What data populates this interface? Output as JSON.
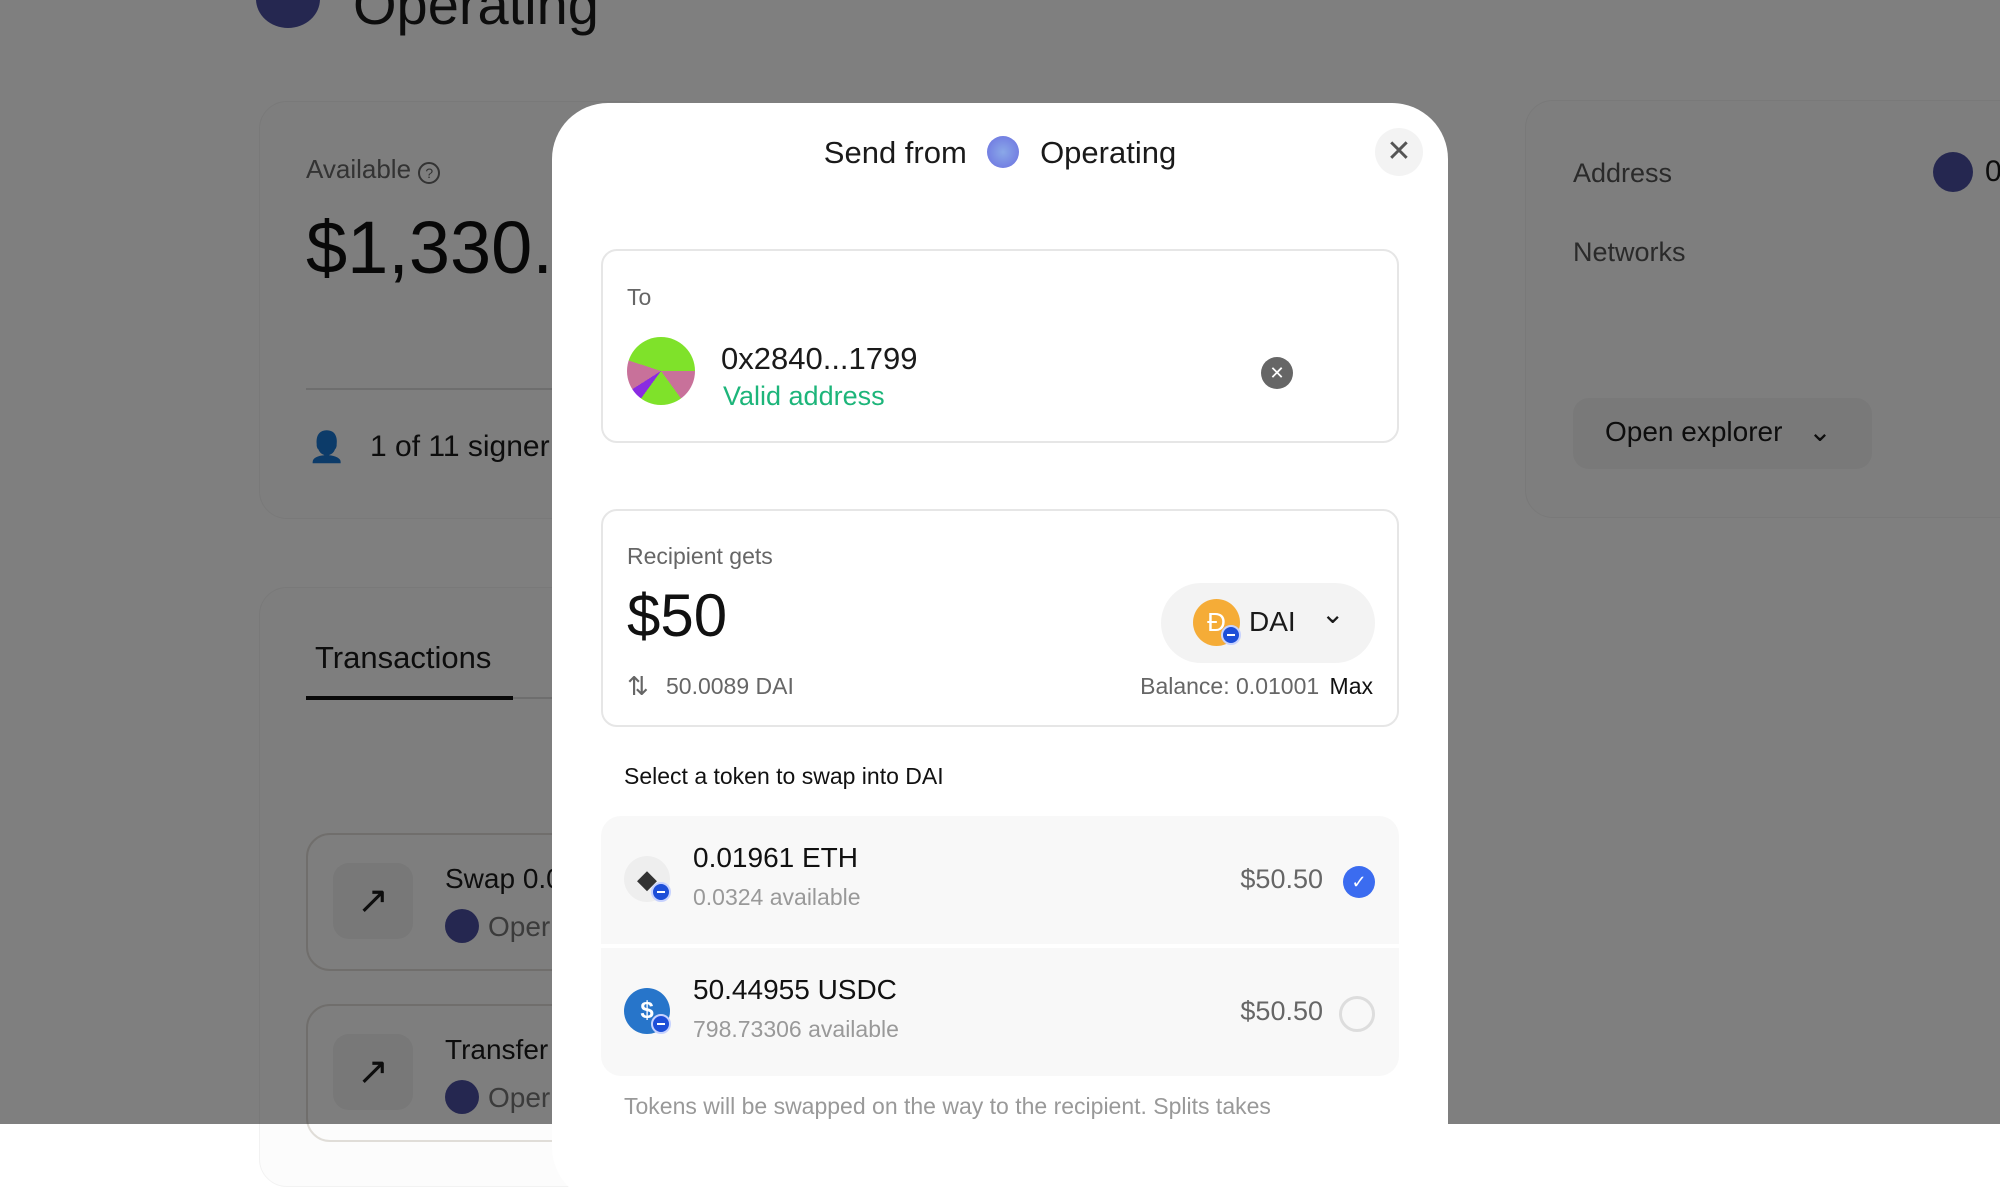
{
  "background": {
    "wallet_title": "Operating",
    "available_label": "Available",
    "available_amount": "$1,330.1",
    "signers": "1 of 11 signer",
    "tab_transactions": "Transactions",
    "transactions": [
      {
        "title": "Swap 0.0",
        "wallet": "Oper"
      },
      {
        "title": "Transfer",
        "wallet": "Oper"
      }
    ],
    "address_label": "Address",
    "address_value": "0",
    "networks_label": "Networks",
    "open_explorer": "Open explorer"
  },
  "modal": {
    "title_prefix": "Send from",
    "wallet_name": "Operating",
    "to_label": "To",
    "recipient_address": "0x2840...1799",
    "address_status": "Valid address",
    "recipient_gets_label": "Recipient gets",
    "amount": "$50",
    "converted": "50.0089 DAI",
    "token": "DAI",
    "balance": "Balance: 0.01001",
    "max_label": "Max",
    "swap_heading": "Select a token to swap into DAI",
    "tokens": [
      {
        "amount": "0.01961 ETH",
        "available": "0.0324 available",
        "usd": "$50.50",
        "selected": true,
        "icon": "ethereum-icon"
      },
      {
        "amount": "50.44955 USDC",
        "available": "798.73306 available",
        "usd": "$50.50",
        "selected": false,
        "icon": "usdc-icon"
      }
    ],
    "footer_note": "Tokens will be swapped on the way to the recipient. Splits takes"
  },
  "colors": {
    "valid": "#1db57a",
    "selected": "#3b6cf0",
    "dai": "#f5ac37",
    "usdc": "#2775ca"
  }
}
